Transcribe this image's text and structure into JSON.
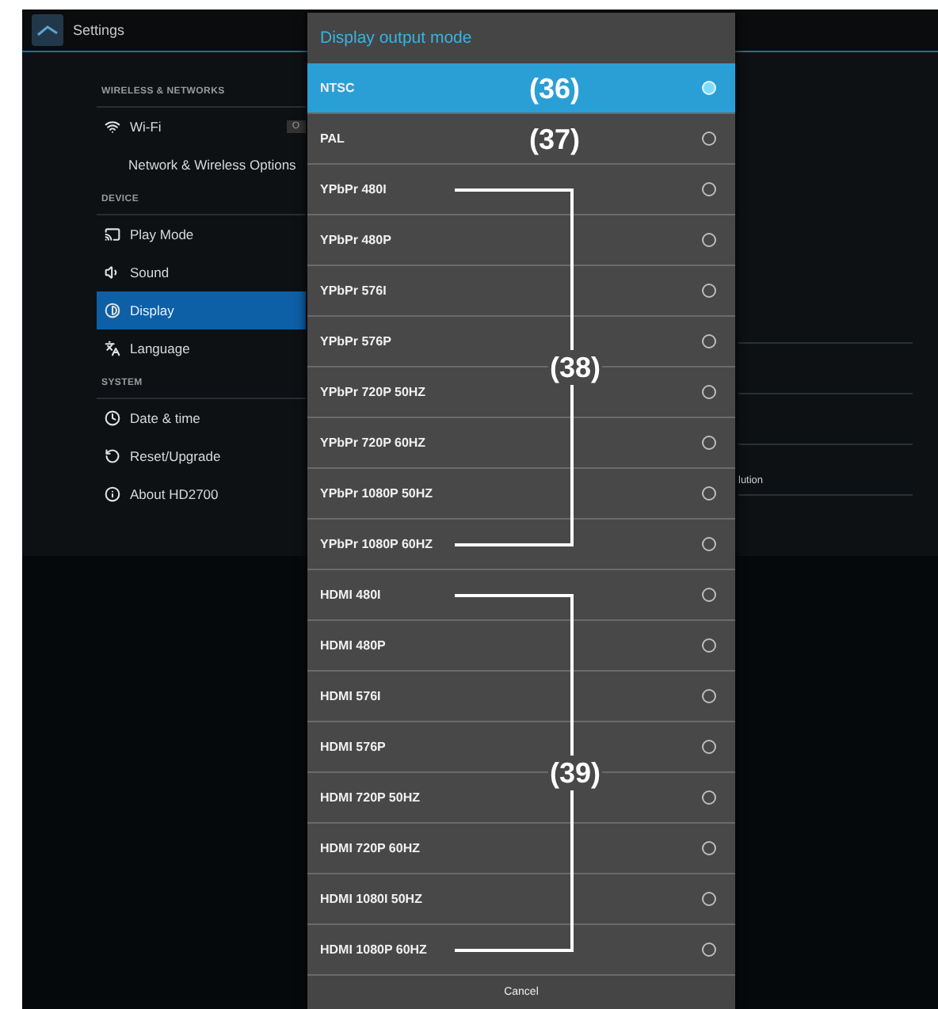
{
  "top_bar": {
    "title": "Settings"
  },
  "sidebar": {
    "sections": [
      {
        "header": "WIRELESS & NETWORKS",
        "items": [
          {
            "label": "Wi-Fi",
            "kind": "wifi",
            "toggle": "O",
            "selected": false
          },
          {
            "label": "Network & Wireless Options",
            "selected": false
          }
        ]
      },
      {
        "header": "DEVICE",
        "items": [
          {
            "label": "Play Mode",
            "kind": "cast",
            "selected": false
          },
          {
            "label": "Sound",
            "kind": "sound",
            "selected": false
          },
          {
            "label": "Display",
            "kind": "display",
            "selected": true
          },
          {
            "label": "Language",
            "kind": "language",
            "selected": false
          }
        ]
      },
      {
        "header": "SYSTEM",
        "items": [
          {
            "label": "Date & time",
            "kind": "clock",
            "selected": false
          },
          {
            "label": "Reset/Upgrade",
            "kind": "reset",
            "selected": false
          },
          {
            "label": "About HD2700",
            "kind": "info",
            "selected": false
          }
        ]
      }
    ]
  },
  "right_pane": {
    "text": "lution"
  },
  "dialog": {
    "title": "Display output mode",
    "option_groups": [
      {
        "callout": "(36)",
        "options": [
          {
            "label": "NTSC",
            "selected": true
          }
        ]
      },
      {
        "callout": "(37)",
        "options": [
          {
            "label": "PAL",
            "selected": false
          }
        ]
      },
      {
        "callout": "(38)",
        "options": [
          {
            "label": "YPbPr 480I",
            "selected": false
          },
          {
            "label": "YPbPr 480P",
            "selected": false
          },
          {
            "label": "YPbPr 576I",
            "selected": false
          },
          {
            "label": "YPbPr 576P",
            "selected": false
          },
          {
            "label": "YPbPr 720P 50HZ",
            "selected": false
          },
          {
            "label": "YPbPr 720P 60HZ",
            "selected": false
          },
          {
            "label": "YPbPr 1080P 50HZ",
            "selected": false
          },
          {
            "label": "YPbPr 1080P 60HZ",
            "selected": false
          }
        ]
      },
      {
        "callout": "(39)",
        "options": [
          {
            "label": "HDMI 480I",
            "selected": false
          },
          {
            "label": "HDMI 480P",
            "selected": false
          },
          {
            "label": "HDMI 576I",
            "selected": false
          },
          {
            "label": "HDMI 576P",
            "selected": false
          },
          {
            "label": "HDMI 720P 50HZ",
            "selected": false
          },
          {
            "label": "HDMI 720P 60HZ",
            "selected": false
          },
          {
            "label": "HDMI 1080I 50HZ",
            "selected": false
          },
          {
            "label": "HDMI 1080P 60HZ",
            "selected": false
          }
        ]
      }
    ],
    "cancel": "Cancel"
  }
}
